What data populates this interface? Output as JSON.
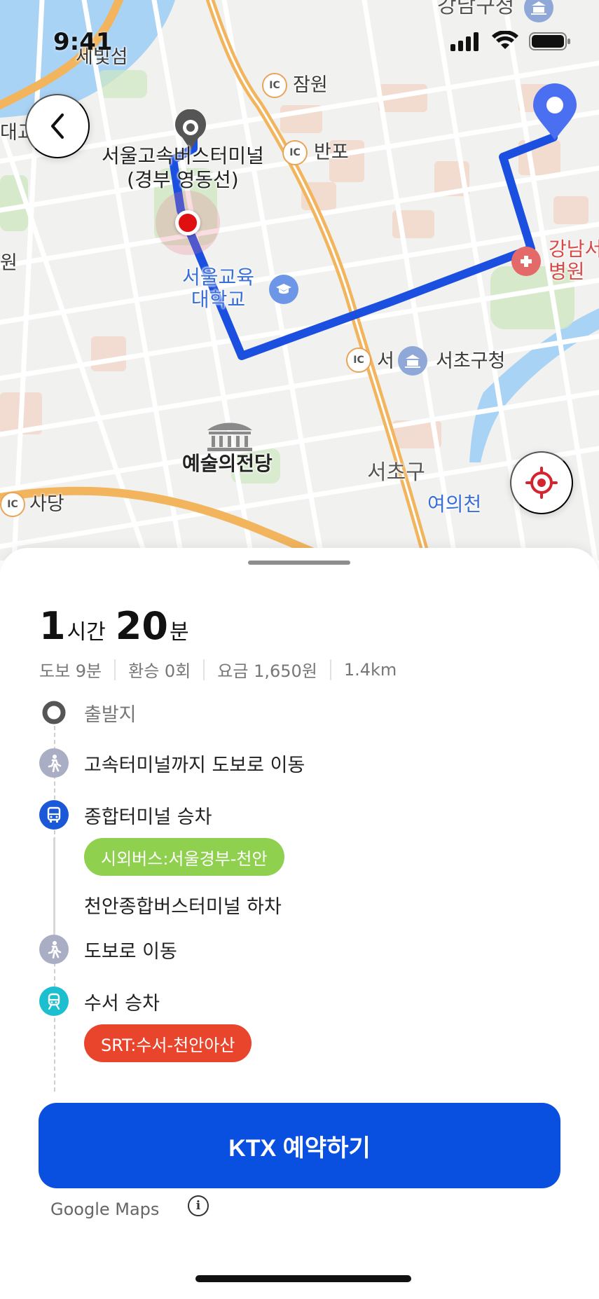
{
  "status_bar": {
    "time": "9:41"
  },
  "map": {
    "labels": {
      "gangnam_gucheong": "강남구청",
      "saebitseom": "세빛섬",
      "daegyo": "대교",
      "jamwon": "잠원",
      "banpo": "반포",
      "terminal_line1": "서울고속버스터미널",
      "terminal_line2": "(경부 영동선)",
      "won": "원",
      "gangnam_hospital_line1": "강남서",
      "gangnam_hospital_line2": "병원",
      "univ_line1": "서울교육",
      "univ_line2": "대학교",
      "seo": "서",
      "seocho_gucheong": "서초구청",
      "arts_center": "예술의전당",
      "seocho_gu": "서초구",
      "yeouicheon": "여의천",
      "sadang": "사당",
      "ic": "IC"
    },
    "colors": {
      "route": "#1b4fe0",
      "destination_pin": "#4a6ff0",
      "origin_marker": "#555555",
      "current_dot": "#e01010"
    }
  },
  "sheet": {
    "duration": {
      "hours": "1",
      "hours_unit": "시간",
      "minutes": "20",
      "minutes_unit": "분"
    },
    "summary": [
      "도보 9분",
      "환승 0회",
      "요금 1,650원",
      "1.4km"
    ],
    "steps": {
      "origin": "출발지",
      "walk1": "고속터미널까지 도보로 이동",
      "bus_board": "종합터미널 승차",
      "bus_chip": "시외버스:서울경부-천안",
      "bus_alight": "천안종합버스터미널 하차",
      "walk2": "도보로 이동",
      "train_board": "수서 승차",
      "train_chip": "SRT:수서-천안아산"
    },
    "chip_colors": {
      "bus": "#8fd14f",
      "train": "#e8452c"
    },
    "cta_label": "KTX 예약하기",
    "attribution": "Google Maps",
    "info_icon": "i"
  }
}
